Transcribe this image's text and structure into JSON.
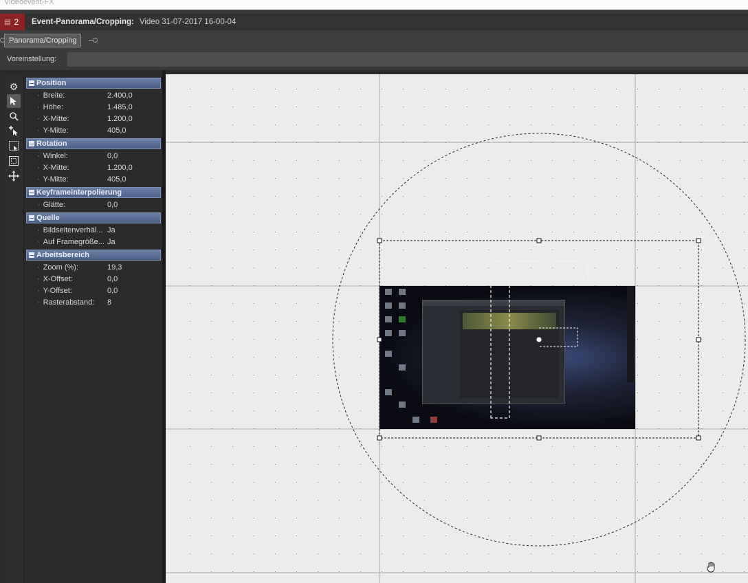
{
  "window": {
    "title": "Videoevent-FX"
  },
  "header": {
    "track_number": "2",
    "title": "Event-Panorama/Cropping:",
    "subtitle": "Video 31-07-2017 16-00-04"
  },
  "chain": {
    "plugin_label": "Panorama/Cropping"
  },
  "preset": {
    "label": "Voreinstellung:",
    "value": ""
  },
  "tools": [
    {
      "icon": "gear-icon"
    },
    {
      "icon": "arrow-pointer-icon"
    },
    {
      "icon": "zoom-icon"
    },
    {
      "icon": "add-keyframe-pointer-icon"
    },
    {
      "icon": "normal-edit-icon"
    },
    {
      "icon": "fit-edit-icon"
    },
    {
      "icon": "move-icon"
    }
  ],
  "properties": {
    "position": {
      "label": "Position",
      "rows": [
        {
          "key": "Breite:",
          "value": "2.400,0"
        },
        {
          "key": "Höhe:",
          "value": "1.485,0"
        },
        {
          "key": "X-Mitte:",
          "value": "1.200,0"
        },
        {
          "key": "Y-Mitte:",
          "value": "405,0"
        }
      ]
    },
    "rotation": {
      "label": "Rotation",
      "rows": [
        {
          "key": "Winkel:",
          "value": "0,0"
        },
        {
          "key": "X-Mitte:",
          "value": "1.200,0"
        },
        {
          "key": "Y-Mitte:",
          "value": "405,0"
        }
      ]
    },
    "keyframe": {
      "label": "Keyframeinterpolierung",
      "rows": [
        {
          "key": "Glätte:",
          "value": "0,0"
        }
      ]
    },
    "source": {
      "label": "Quelle",
      "rows": [
        {
          "key": "Bildseitenverhäl...",
          "value": "Ja"
        },
        {
          "key": "Auf Framegröße...",
          "value": "Ja"
        }
      ]
    },
    "workspace": {
      "label": "Arbeitsbereich",
      "rows": [
        {
          "key": "Zoom (%):",
          "value": "19,3"
        },
        {
          "key": "X-Offset:",
          "value": "0,0"
        },
        {
          "key": "Y-Offset:",
          "value": "0,0"
        },
        {
          "key": "Rasterabstand:",
          "value": "8"
        }
      ]
    }
  },
  "colors": {
    "section_header": "#5a6e96",
    "canvas": "#ececec",
    "track_badge": "#8a2424"
  }
}
